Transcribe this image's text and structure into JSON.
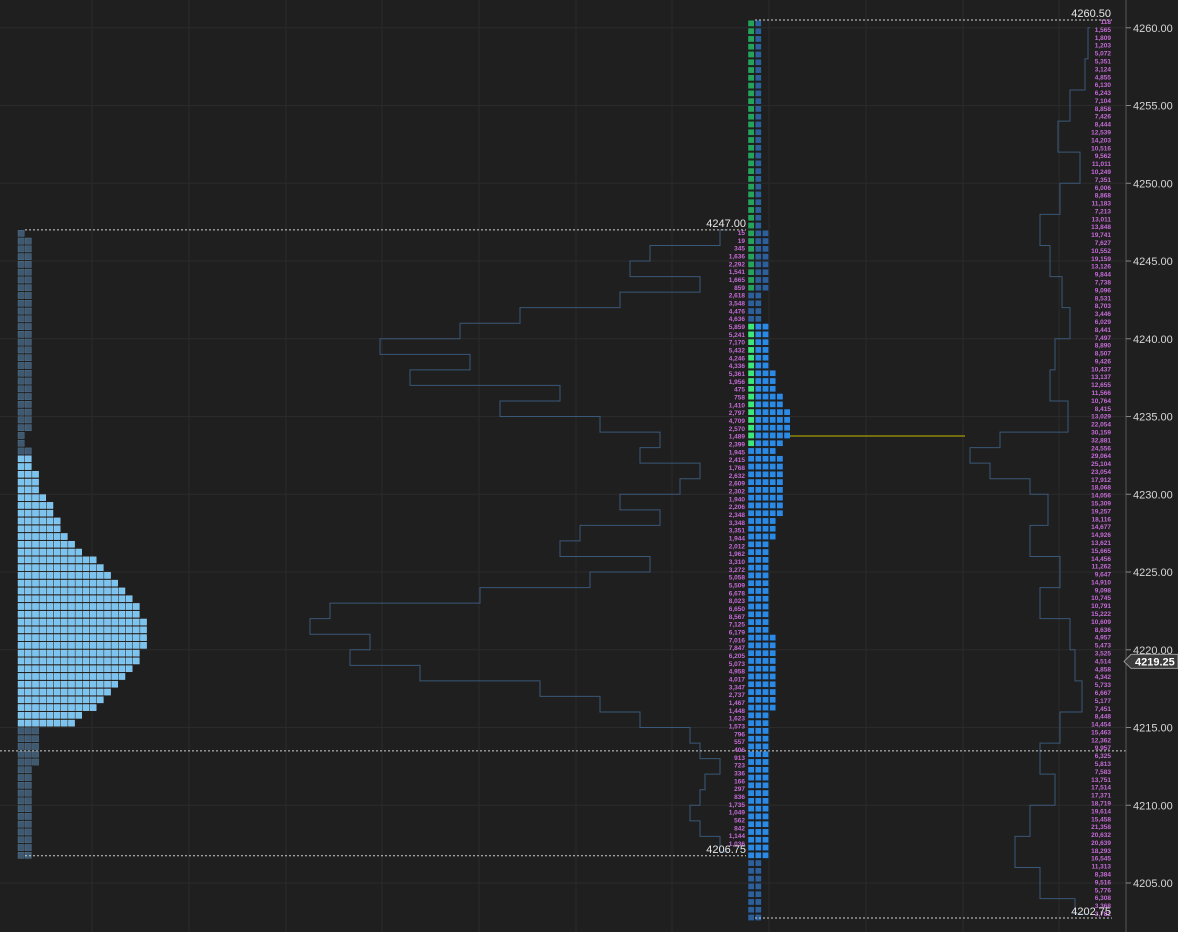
{
  "chart_data": {
    "type": "market-profile",
    "price_axis": {
      "min": 4202.75,
      "max": 4260.5,
      "ticks": [
        "4205.00",
        "4210.00",
        "4215.00",
        "4220.00",
        "4225.00",
        "4230.00",
        "4235.00",
        "4240.00",
        "4245.00",
        "4250.00",
        "4255.00",
        "4260.00"
      ]
    },
    "current_price": "4219.25",
    "prior_session": {
      "high_label": "4247.00",
      "low_label": "4206.75",
      "high": 4247.0,
      "low": 4206.75,
      "poc": 4221.0
    },
    "current_session": {
      "high_label": "4260.50",
      "low_label": "4202.75",
      "high": 4260.5,
      "low": 4202.75,
      "poc": 4230.5
    },
    "reference_price": 4213.5,
    "volume_labels_top": [
      "118",
      "1,565",
      "1,809",
      "1,203",
      "5,072",
      "5,351",
      "3,124",
      "4,855",
      "6,130",
      "6,243",
      "7,104",
      "8,858",
      "7,426",
      "8,444",
      "12,539",
      "14,203",
      "10,516",
      "9,562",
      "11,011",
      "10,249",
      "7,351",
      "6,006",
      "8,868",
      "11,183",
      "7,213",
      "13,011",
      "13,848",
      "19,741",
      "7,627",
      "10,552",
      "19,159",
      "13,126",
      "9,844",
      "7,738",
      "9,096",
      "8,531",
      "8,703",
      "3,446",
      "6,029",
      "8,441",
      "7,497",
      "8,890",
      "8,507",
      "9,426",
      "10,437",
      "13,137",
      "12,655",
      "11,566",
      "10,764",
      "8,415",
      "13,029",
      "22,054",
      "30,159",
      "32,881",
      "24,556",
      "29,064",
      "25,104",
      "23,054",
      "17,912",
      "18,068",
      "14,056",
      "15,309",
      "19,257",
      "18,116",
      "14,677",
      "14,926",
      "13,621",
      "15,665",
      "14,456",
      "11,262",
      "9,647",
      "14,910",
      "9,098",
      "10,745",
      "10,791",
      "15,222",
      "10,609",
      "8,636",
      "4,957",
      "5,473",
      "3,525",
      "4,514",
      "4,858",
      "4,342",
      "5,733",
      "6,667",
      "5,177",
      "7,451",
      "8,448",
      "14,454",
      "15,463",
      "12,362",
      "9,957",
      "6,325",
      "5,813",
      "7,583",
      "13,751",
      "17,514",
      "17,371",
      "18,719",
      "19,614",
      "15,458",
      "21,358",
      "20,632",
      "20,639",
      "18,293",
      "16,545",
      "11,313",
      "8,384",
      "9,516",
      "5,776",
      "6,308",
      "3,368",
      "3,782"
    ],
    "volume_labels_mid": [
      "15",
      "19",
      "345",
      "1,636",
      "2,292",
      "1,541",
      "1,665",
      "859",
      "2,618",
      "3,548",
      "4,476",
      "4,636",
      "5,859",
      "5,241",
      "7,170",
      "5,432",
      "4,246",
      "4,336",
      "5,361",
      "1,956",
      "475",
      "758",
      "1,410",
      "2,797",
      "4,709",
      "2,570",
      "1,489",
      "2,399",
      "1,945",
      "2,415",
      "1,768",
      "2,632",
      "2,609",
      "2,302",
      "1,940",
      "2,206",
      "2,348",
      "3,348",
      "3,351",
      "1,944",
      "2,012",
      "1,962",
      "3,310",
      "3,272",
      "5,058",
      "5,509",
      "6,678",
      "8,023",
      "6,650",
      "8,567",
      "7,125",
      "6,179",
      "7,016",
      "7,847",
      "6,205",
      "5,073",
      "4,958",
      "4,017",
      "3,347",
      "2,737",
      "1,467",
      "1,448",
      "1,623",
      "1,573",
      "796",
      "557",
      "406",
      "913",
      "723",
      "336",
      "166",
      "297",
      "836",
      "1,735",
      "1,049",
      "562",
      "842",
      "1,144",
      "1,036"
    ]
  }
}
